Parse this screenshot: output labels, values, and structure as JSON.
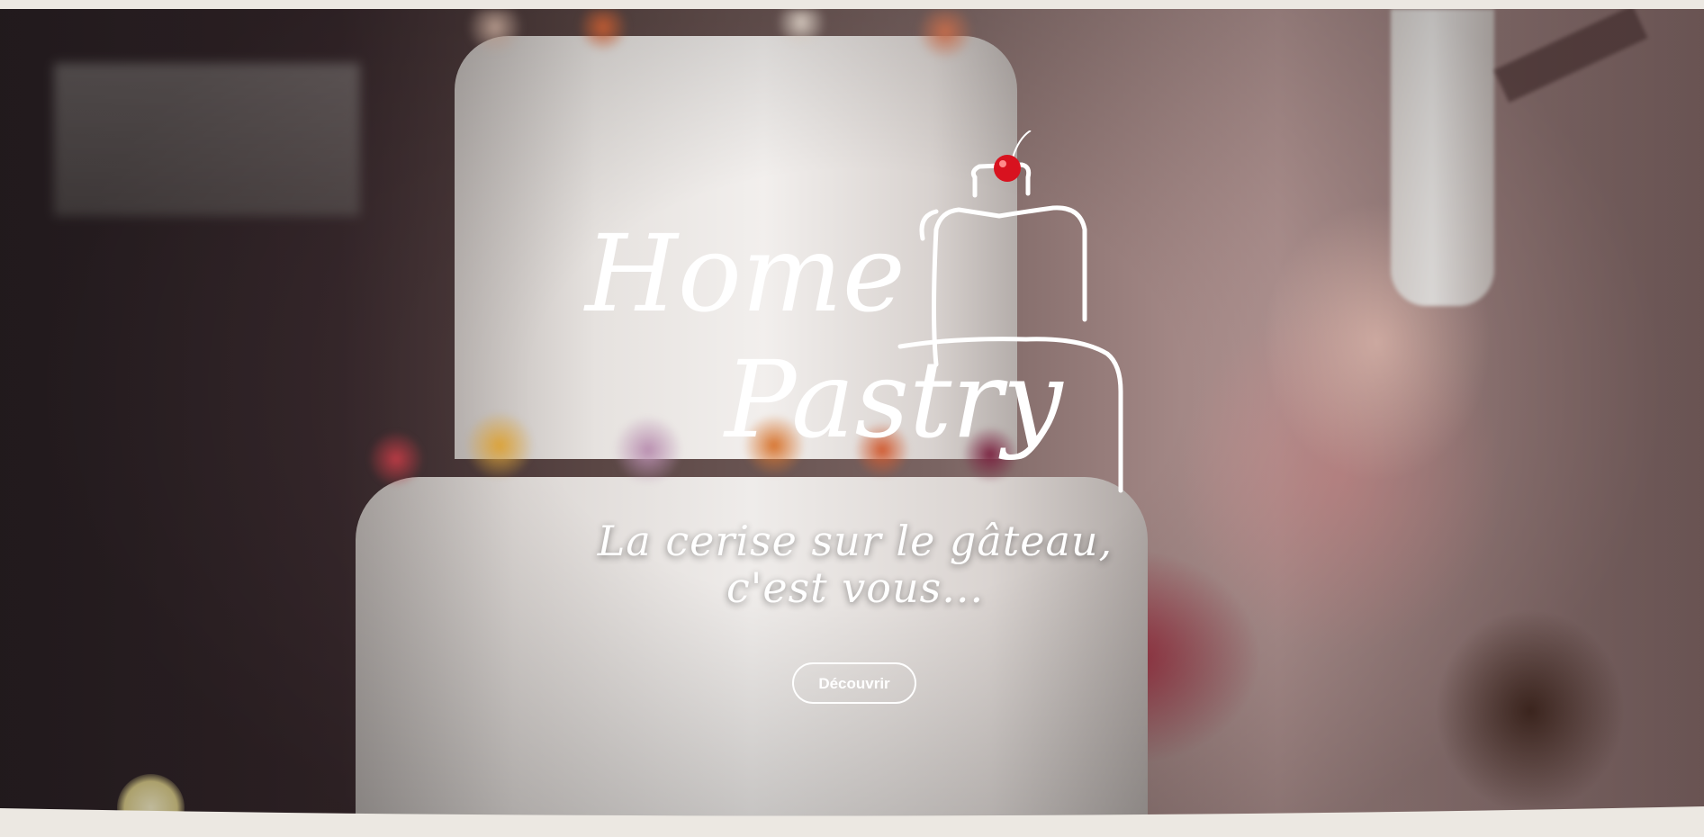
{
  "hero": {
    "logo_alt": "Home Pastry",
    "logo_line1": "Home",
    "logo_line2": "Pastry",
    "tagline_line1": "La cerise sur le gâteau,",
    "tagline_line2": "c'est vous...",
    "cta_label": "Découvrir",
    "icons": [
      "cake-outline-icon",
      "cherry-icon"
    ],
    "colors": {
      "text": "#ffffff",
      "cherry": "#d8121f",
      "page_background": "#ece8e2"
    }
  }
}
